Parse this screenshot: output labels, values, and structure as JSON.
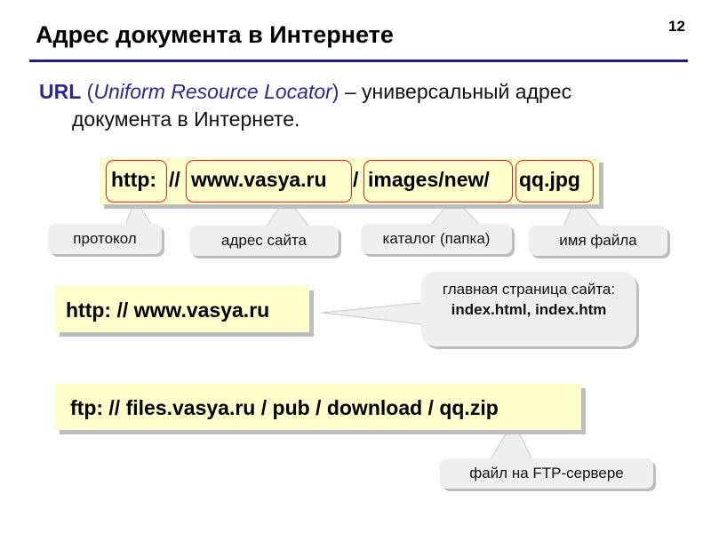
{
  "slide": {
    "title": "Адрес документа в Интернете",
    "page_number": "12"
  },
  "intro": {
    "url_label": "URL",
    "paren_open": "(",
    "expansion": "Uniform Resource Locator",
    "paren_close": ")",
    "text_line1": " – универсальный адрес",
    "text_line2": "документа в Интернете."
  },
  "url_parts": {
    "protocol": "http:",
    "sep1": "//",
    "host": "www.vasya.ru",
    "sep2": "/",
    "path": "images/new/",
    "file": "qq.jpg"
  },
  "callouts": {
    "protocol": "протокол",
    "site_address": "адрес сайта",
    "catalog": "каталог (папка)",
    "file_name": "имя файла"
  },
  "example2": {
    "url": "http: // www.vasya.ru",
    "note_line1": "главная страница сайта:",
    "note_line2": "index.html, index.htm"
  },
  "example3": {
    "url": "ftp: // files.vasya.ru / pub / download / qq.zip",
    "note": "файл на FTP-сервере"
  }
}
